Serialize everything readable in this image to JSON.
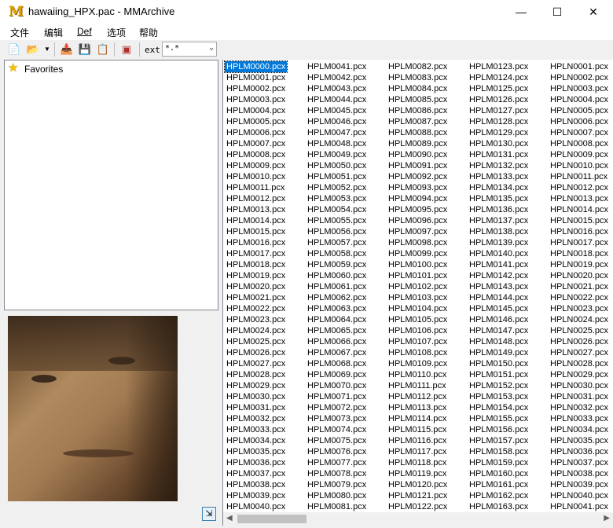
{
  "window": {
    "title": "hawaiing_HPX.pac - MMArchive",
    "app_icon_glyph": "M",
    "minimize_glyph": "—",
    "maximize_glyph": "☐",
    "close_glyph": "✕"
  },
  "menu": [
    "文件",
    "编辑",
    "Def",
    "选项",
    "帮助"
  ],
  "toolbar": {
    "ext_label": "ext",
    "ext_value": "*.*",
    "icons": [
      "new-document-icon",
      "open-folder-icon",
      "dropdown-arrow-icon",
      "add-files-icon",
      "extract-icon",
      "extract-all-icon",
      "cube-icon"
    ]
  },
  "tree": {
    "favorites_label": "Favorites"
  },
  "file_list": {
    "selected": "HPLM0000.pcx",
    "columns": [
      [
        "HPLM0000.pcx",
        "HPLM0001.pcx",
        "HPLM0002.pcx",
        "HPLM0003.pcx",
        "HPLM0004.pcx",
        "HPLM0005.pcx",
        "HPLM0006.pcx",
        "HPLM0007.pcx",
        "HPLM0008.pcx",
        "HPLM0009.pcx",
        "HPLM0010.pcx",
        "HPLM0011.pcx",
        "HPLM0012.pcx",
        "HPLM0013.pcx",
        "HPLM0014.pcx",
        "HPLM0015.pcx",
        "HPLM0016.pcx",
        "HPLM0017.pcx",
        "HPLM0018.pcx",
        "HPLM0019.pcx",
        "HPLM0020.pcx",
        "HPLM0021.pcx",
        "HPLM0022.pcx",
        "HPLM0023.pcx",
        "HPLM0024.pcx",
        "HPLM0025.pcx",
        "HPLM0026.pcx",
        "HPLM0027.pcx",
        "HPLM0028.pcx",
        "HPLM0029.pcx",
        "HPLM0030.pcx",
        "HPLM0031.pcx",
        "HPLM0032.pcx",
        "HPLM0033.pcx",
        "HPLM0034.pcx",
        "HPLM0035.pcx",
        "HPLM0036.pcx",
        "HPLM0037.pcx",
        "HPLM0038.pcx",
        "HPLM0039.pcx",
        "HPLM0040.pcx"
      ],
      [
        "HPLM0041.pcx",
        "HPLM0042.pcx",
        "HPLM0043.pcx",
        "HPLM0044.pcx",
        "HPLM0045.pcx",
        "HPLM0046.pcx",
        "HPLM0047.pcx",
        "HPLM0048.pcx",
        "HPLM0049.pcx",
        "HPLM0050.pcx",
        "HPLM0051.pcx",
        "HPLM0052.pcx",
        "HPLM0053.pcx",
        "HPLM0054.pcx",
        "HPLM0055.pcx",
        "HPLM0056.pcx",
        "HPLM0057.pcx",
        "HPLM0058.pcx",
        "HPLM0059.pcx",
        "HPLM0060.pcx",
        "HPLM0061.pcx",
        "HPLM0062.pcx",
        "HPLM0063.pcx",
        "HPLM0064.pcx",
        "HPLM0065.pcx",
        "HPLM0066.pcx",
        "HPLM0067.pcx",
        "HPLM0068.pcx",
        "HPLM0069.pcx",
        "HPLM0070.pcx",
        "HPLM0071.pcx",
        "HPLM0072.pcx",
        "HPLM0073.pcx",
        "HPLM0074.pcx",
        "HPLM0075.pcx",
        "HPLM0076.pcx",
        "HPLM0077.pcx",
        "HPLM0078.pcx",
        "HPLM0079.pcx",
        "HPLM0080.pcx",
        "HPLM0081.pcx"
      ],
      [
        "HPLM0082.pcx",
        "HPLM0083.pcx",
        "HPLM0084.pcx",
        "HPLM0085.pcx",
        "HPLM0086.pcx",
        "HPLM0087.pcx",
        "HPLM0088.pcx",
        "HPLM0089.pcx",
        "HPLM0090.pcx",
        "HPLM0091.pcx",
        "HPLM0092.pcx",
        "HPLM0093.pcx",
        "HPLM0094.pcx",
        "HPLM0095.pcx",
        "HPLM0096.pcx",
        "HPLM0097.pcx",
        "HPLM0098.pcx",
        "HPLM0099.pcx",
        "HPLM0100.pcx",
        "HPLM0101.pcx",
        "HPLM0102.pcx",
        "HPLM0103.pcx",
        "HPLM0104.pcx",
        "HPLM0105.pcx",
        "HPLM0106.pcx",
        "HPLM0107.pcx",
        "HPLM0108.pcx",
        "HPLM0109.pcx",
        "HPLM0110.pcx",
        "HPLM0111.pcx",
        "HPLM0112.pcx",
        "HPLM0113.pcx",
        "HPLM0114.pcx",
        "HPLM0115.pcx",
        "HPLM0116.pcx",
        "HPLM0117.pcx",
        "HPLM0118.pcx",
        "HPLM0119.pcx",
        "HPLM0120.pcx",
        "HPLM0121.pcx",
        "HPLM0122.pcx"
      ],
      [
        "HPLM0123.pcx",
        "HPLM0124.pcx",
        "HPLM0125.pcx",
        "HPLM0126.pcx",
        "HPLM0127.pcx",
        "HPLM0128.pcx",
        "HPLM0129.pcx",
        "HPLM0130.pcx",
        "HPLM0131.pcx",
        "HPLM0132.pcx",
        "HPLM0133.pcx",
        "HPLM0134.pcx",
        "HPLM0135.pcx",
        "HPLM0136.pcx",
        "HPLM0137.pcx",
        "HPLM0138.pcx",
        "HPLM0139.pcx",
        "HPLM0140.pcx",
        "HPLM0141.pcx",
        "HPLM0142.pcx",
        "HPLM0143.pcx",
        "HPLM0144.pcx",
        "HPLM0145.pcx",
        "HPLM0146.pcx",
        "HPLM0147.pcx",
        "HPLM0148.pcx",
        "HPLM0149.pcx",
        "HPLM0150.pcx",
        "HPLM0151.pcx",
        "HPLM0152.pcx",
        "HPLM0153.pcx",
        "HPLM0154.pcx",
        "HPLM0155.pcx",
        "HPLM0156.pcx",
        "HPLM0157.pcx",
        "HPLM0158.pcx",
        "HPLM0159.pcx",
        "HPLM0160.pcx",
        "HPLM0161.pcx",
        "HPLM0162.pcx",
        "HPLM0163.pcx"
      ],
      [
        "HPLN0001.pcx",
        "HPLN0002.pcx",
        "HPLN0003.pcx",
        "HPLN0004.pcx",
        "HPLN0005.pcx",
        "HPLN0006.pcx",
        "HPLN0007.pcx",
        "HPLN0008.pcx",
        "HPLN0009.pcx",
        "HPLN0010.pcx",
        "HPLN0011.pcx",
        "HPLN0012.pcx",
        "HPLN0013.pcx",
        "HPLN0014.pcx",
        "HPLN0015.pcx",
        "HPLN0016.pcx",
        "HPLN0017.pcx",
        "HPLN0018.pcx",
        "HPLN0019.pcx",
        "HPLN0020.pcx",
        "HPLN0021.pcx",
        "HPLN0022.pcx",
        "HPLN0023.pcx",
        "HPLN0024.pcx",
        "HPLN0025.pcx",
        "HPLN0026.pcx",
        "HPLN0027.pcx",
        "HPLN0028.pcx",
        "HPLN0029.pcx",
        "HPLN0030.pcx",
        "HPLN0031.pcx",
        "HPLN0032.pcx",
        "HPLN0033.pcx",
        "HPLN0034.pcx",
        "HPLN0035.pcx",
        "HPLN0036.pcx",
        "HPLN0037.pcx",
        "HPLN0038.pcx",
        "HPLN0039.pcx",
        "HPLN0040.pcx",
        "HPLN0041.pcx"
      ]
    ]
  },
  "colors": {
    "selection": "#0078d7",
    "window": "#f0f0f0",
    "list_bg": "#ffffff"
  }
}
